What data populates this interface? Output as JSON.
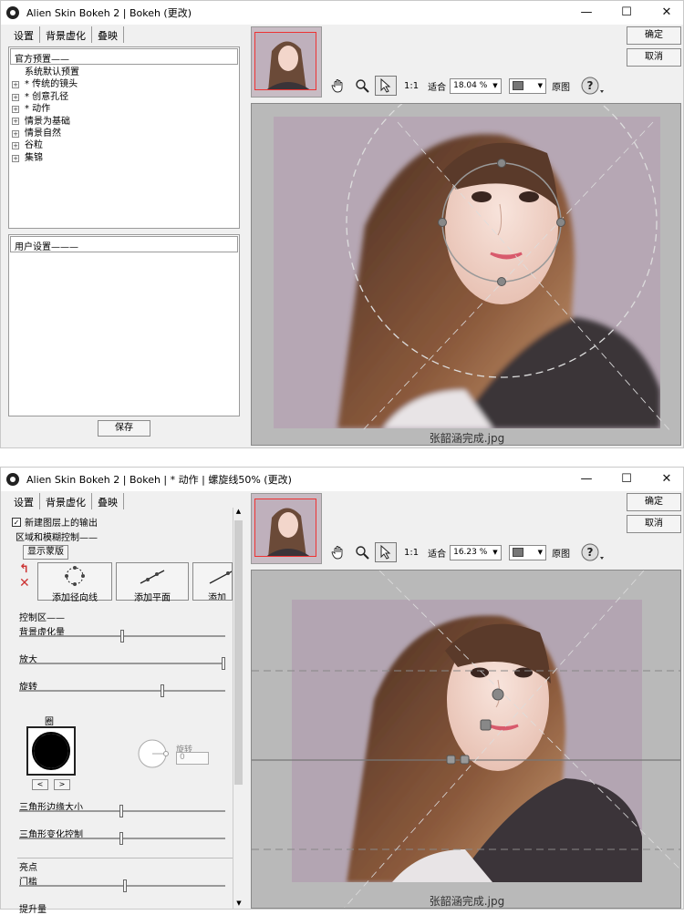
{
  "window1": {
    "title": "Alien Skin Bokeh 2 | Bokeh (更改)",
    "tabs": [
      "设置",
      "背景虚化",
      "叠映"
    ],
    "official_presets_label": "官方预置——",
    "presets": [
      {
        "label": "系统默认预置",
        "expandable": false
      },
      {
        "label": "* 传统的镜头",
        "expandable": true
      },
      {
        "label": "* 创意孔径",
        "expandable": true
      },
      {
        "label": "* 动作",
        "expandable": true
      },
      {
        "label": "情景为基础",
        "expandable": true
      },
      {
        "label": "情景自然",
        "expandable": true
      },
      {
        "label": "谷粒",
        "expandable": true
      },
      {
        "label": "集锦",
        "expandable": true
      }
    ],
    "user_settings_label": "用户设置———",
    "save_label": "保存",
    "ok_label": "确定",
    "cancel_label": "取消",
    "zoom_1to1": "1:1",
    "fit_label": "适合",
    "zoom_value": "18.04 %",
    "original_label": "原图",
    "help_icon": "?",
    "filename": "张韶涵完成.jpg"
  },
  "window2": {
    "title": "Alien Skin Bokeh 2 | Bokeh | * 动作 | 螺旋线50% (更改)",
    "tabs": [
      "设置",
      "背景虚化",
      "叠映"
    ],
    "new_layer_label": "新建图层上的输出",
    "region_label": "区域和模糊控制——",
    "show_mask_label": "显示蒙版",
    "add_radial_label": "添加径向线",
    "add_plane_label": "添加平面",
    "add_third_label": "添加羊",
    "control_area_label": "控制区——",
    "sliders": [
      {
        "label": "背景虚化量",
        "value": 0.5
      },
      {
        "label": "放大",
        "value": 1.0
      },
      {
        "label": "旋转",
        "value": 0.7
      }
    ],
    "circle_label": "圈",
    "rotate_label": "旋转",
    "rotate_value": "0",
    "triangle_size_label": "三角形边缘大小",
    "triangle_change_label": "三角形变化控制",
    "highlight_label": "亮点",
    "threshold_label": "门槛",
    "boost_label": "提升量",
    "ok_label": "确定",
    "cancel_label": "取消",
    "zoom_1to1": "1:1",
    "fit_label": "适合",
    "zoom_value": "16.23 %",
    "original_label": "原图",
    "help_icon": "?",
    "filename": "张韶涵完成.jpg"
  }
}
